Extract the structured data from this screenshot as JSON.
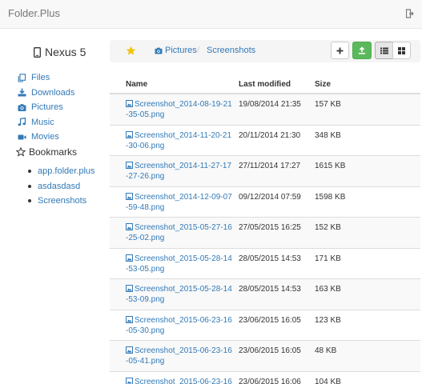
{
  "app": {
    "brand": "Folder.Plus"
  },
  "device": {
    "name": "Nexus 5"
  },
  "sidebar": {
    "items": [
      {
        "label": "Files",
        "icon": "files-icon"
      },
      {
        "label": "Downloads",
        "icon": "download-icon"
      },
      {
        "label": "Pictures",
        "icon": "camera-icon"
      },
      {
        "label": "Music",
        "icon": "music-icon"
      },
      {
        "label": "Movies",
        "icon": "video-icon"
      }
    ],
    "bookmarks_title": "Bookmarks",
    "bookmarks": [
      "app.folder.plus",
      "asdasdasd",
      "Screenshots"
    ]
  },
  "breadcrumb": [
    "Pictures",
    "Screenshots"
  ],
  "table": {
    "headers": {
      "name": "Name",
      "modified": "Last modified",
      "size": "Size"
    },
    "rows": [
      {
        "name": "Screenshot_2014-08-19-21-35-05.png",
        "modified": "19/08/2014 21:35",
        "size": "157 KB"
      },
      {
        "name": "Screenshot_2014-11-20-21-30-06.png",
        "modified": "20/11/2014 21:30",
        "size": "348 KB"
      },
      {
        "name": "Screenshot_2014-11-27-17-27-26.png",
        "modified": "27/11/2014 17:27",
        "size": "1615 KB"
      },
      {
        "name": "Screenshot_2014-12-09-07-59-48.png",
        "modified": "09/12/2014 07:59",
        "size": "1598 KB"
      },
      {
        "name": "Screenshot_2015-05-27-16-25-02.png",
        "modified": "27/05/2015 16:25",
        "size": "152 KB"
      },
      {
        "name": "Screenshot_2015-05-28-14-53-05.png",
        "modified": "28/05/2015 14:53",
        "size": "171 KB"
      },
      {
        "name": "Screenshot_2015-05-28-14-53-09.png",
        "modified": "28/05/2015 14:53",
        "size": "163 KB"
      },
      {
        "name": "Screenshot_2015-06-23-16-05-30.png",
        "modified": "23/06/2015 16:05",
        "size": "123 KB"
      },
      {
        "name": "Screenshot_2015-06-23-16-05-41.png",
        "modified": "23/06/2015 16:05",
        "size": "48 KB"
      },
      {
        "name": "Screenshot_2015-06-23-16-",
        "modified": "23/06/2015 16:06",
        "size": "104 KB"
      }
    ]
  },
  "colors": {
    "link": "#337ab7",
    "upload": "#5cb85c",
    "star": "#f0c30f"
  }
}
